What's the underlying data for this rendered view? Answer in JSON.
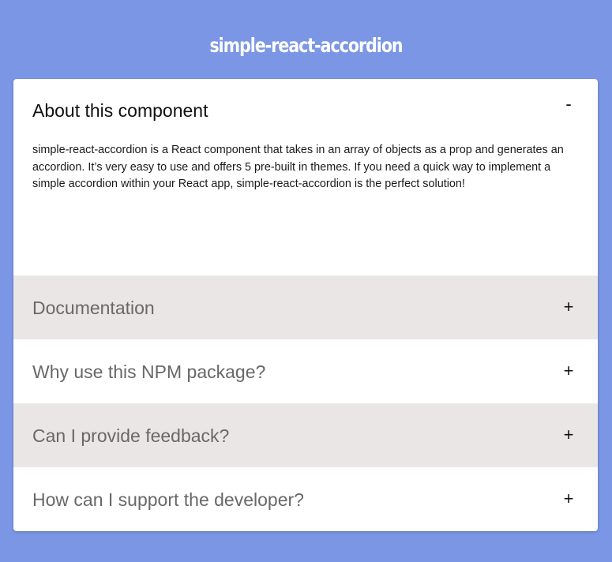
{
  "header": {
    "title": "simple-react-accordion"
  },
  "accordion": {
    "items": [
      {
        "title": "About this component",
        "toggle": "-",
        "state": "expanded",
        "body": "simple-react-accordion is a React component that takes in an array of objects as a prop and generates an accordion. It’s very easy to use and offers 5 pre-built in themes. If you need a quick way to implement a simple accordion within your React app, simple-react-accordion is the perfect solution!"
      },
      {
        "title": "Documentation",
        "toggle": "+",
        "state": "collapsed"
      },
      {
        "title": "Why use this NPM package?",
        "toggle": "+",
        "state": "collapsed"
      },
      {
        "title": "Can I provide feedback?",
        "toggle": "+",
        "state": "collapsed"
      },
      {
        "title": "How can I support the developer?",
        "toggle": "+",
        "state": "collapsed"
      }
    ]
  },
  "colors": {
    "background": "#7b96e4",
    "card": "#ffffff",
    "shaded_row": "#ebe6e6",
    "collapsed_title": "#686868",
    "expanded_title": "#111111"
  }
}
